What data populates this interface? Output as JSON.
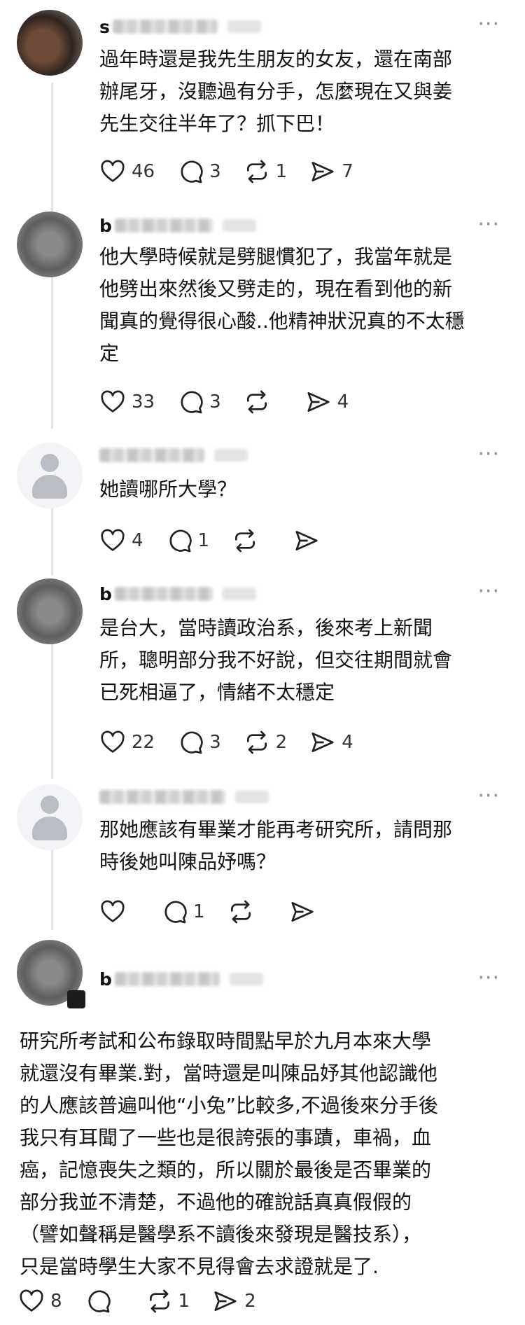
{
  "comments": [
    {
      "author_initial": "s",
      "text": "過年時還是我先生朋友的女友，還在南部\n辦尾牙，沒聽過有分手，怎麼現在又與姜\n先生交往半年了？抓下巴！",
      "likes": "46",
      "replies": "3",
      "reposts": "1",
      "shares": "7"
    },
    {
      "author_initial": "b",
      "text": "他大學時候就是劈腿慣犯了，我當年就是\n他劈出來然後又劈走的，現在看到他的新\n聞真的覺得很心酸..他精神狀況真的不太穩\n定",
      "likes": "33",
      "replies": "3",
      "reposts": "",
      "shares": "4"
    },
    {
      "author_initial": "",
      "text": "她讀哪所大學？",
      "likes": "4",
      "replies": "1",
      "reposts": "",
      "shares": ""
    },
    {
      "author_initial": "b",
      "text": "是台大，當時讀政治系，後來考上新聞\n所，聰明部分我不好說，但交往期間就會\n已死相逼了，情緒不太穩定",
      "likes": "22",
      "replies": "3",
      "reposts": "2",
      "shares": "4"
    },
    {
      "author_initial": "",
      "text": "那她應該有畢業才能再考研究所，請問那\n時後她叫陳品妤嗎？",
      "likes": "",
      "replies": "1",
      "reposts": "",
      "shares": ""
    },
    {
      "author_initial": "b",
      "text": "研究所考試和公布錄取時間點早於九月本來大學\n就還沒有畢業.對，當時還是叫陳品妤其他認識他\n的人應該普遍叫他“小兔”比較多,不過後來分手後\n我只有耳聞了一些也是很誇張的事蹟，車禍，血\n癌，記憶喪失之類的，所以關於最後是否畢業的\n部分我並不清楚，不過他的確說話真真假假的\n（譬如聲稱是醫學系不讀後來發現是醫技系），\n只是當時學生大家不見得會去求證就是了.",
      "likes": "8",
      "replies": "",
      "reposts": "1",
      "shares": "2"
    }
  ],
  "more_label": "···",
  "icons": [
    "heart-icon",
    "comment-icon",
    "repost-icon",
    "share-icon",
    "more-icon"
  ]
}
